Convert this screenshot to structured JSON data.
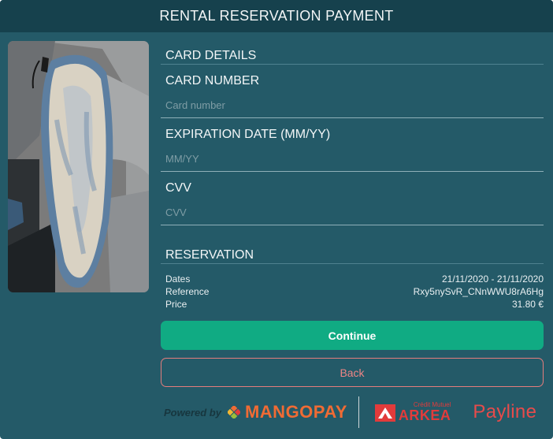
{
  "header": {
    "title": "RENTAL RESERVATION PAYMENT"
  },
  "card_details": {
    "section_title": "CARD DETAILS",
    "card_number": {
      "label": "CARD NUMBER",
      "value": "",
      "placeholder": "Card number"
    },
    "expiration": {
      "label": "EXPIRATION DATE (MM/YY)",
      "value": "",
      "placeholder": "MM/YY"
    },
    "cvv": {
      "label": "CVV",
      "value": "",
      "placeholder": "CVV"
    }
  },
  "reservation": {
    "section_title": "RESERVATION",
    "rows": [
      {
        "label": "Dates",
        "value": "21/11/2020 - 21/11/2020"
      },
      {
        "label": "Reference",
        "value": "Rxy5nySvR_CNnWWU8rA6Hg"
      },
      {
        "label": "Price",
        "value": "31.80 €"
      }
    ]
  },
  "buttons": {
    "continue_label": "Continue",
    "back_label": "Back"
  },
  "footer": {
    "powered_by": "Powered by",
    "mangopay": "MANGOPAY",
    "arkea_small": "Crédit Mutuel",
    "arkea_big": "ARKEA",
    "payline": "Payline"
  },
  "colors": {
    "modal_bg": "#245a68",
    "header_bg": "#16414d",
    "continue_bg": "#10ab83",
    "back_border": "#e47d7d",
    "mangopay_orange": "#f06b34",
    "arkea_red": "#e23b3b"
  },
  "icons": {
    "product_image": "surfboard-photo",
    "mangopay_logo": "mangopay-diamond-icon",
    "arkea_logo": "arkea-arrow-icon"
  }
}
